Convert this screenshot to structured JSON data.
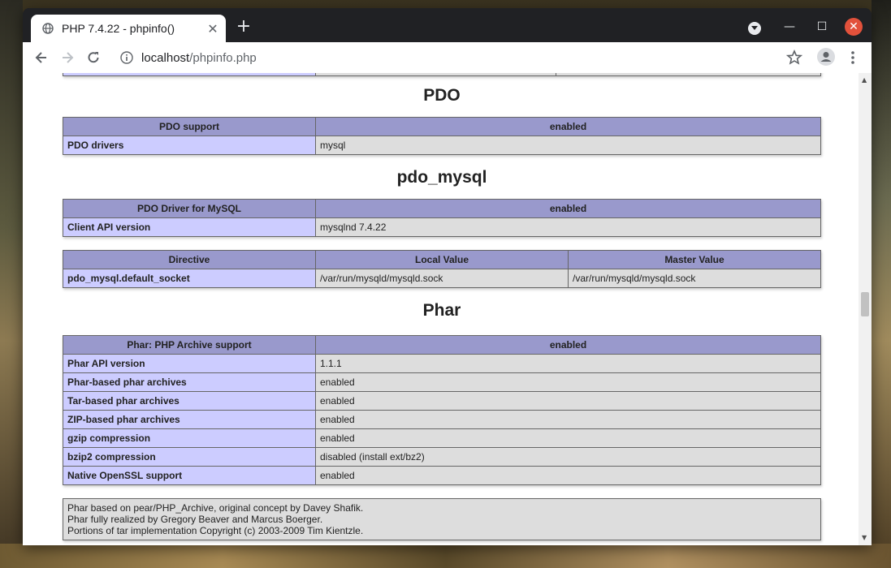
{
  "tab": {
    "title": "PHP 7.4.22 - phpinfo()"
  },
  "omnibox": {
    "host": "localhost",
    "path": "/phpinfo.php"
  },
  "sections": {
    "pdo": {
      "heading": "PDO",
      "header": [
        "PDO support",
        "enabled"
      ],
      "rows": [
        [
          "PDO drivers",
          "mysql"
        ]
      ]
    },
    "pdo_mysql": {
      "heading": "pdo_mysql",
      "header": [
        "PDO Driver for MySQL",
        "enabled"
      ],
      "rows": [
        [
          "Client API version",
          "mysqlnd 7.4.22"
        ]
      ],
      "directive_header": [
        "Directive",
        "Local Value",
        "Master Value"
      ],
      "directive_rows": [
        [
          "pdo_mysql.default_socket",
          "/var/run/mysqld/mysqld.sock",
          "/var/run/mysqld/mysqld.sock"
        ]
      ]
    },
    "phar": {
      "heading": "Phar",
      "header": [
        "Phar: PHP Archive support",
        "enabled"
      ],
      "rows": [
        [
          "Phar API version",
          "1.1.1"
        ],
        [
          "Phar-based phar archives",
          "enabled"
        ],
        [
          "Tar-based phar archives",
          "enabled"
        ],
        [
          "ZIP-based phar archives",
          "enabled"
        ],
        [
          "gzip compression",
          "enabled"
        ],
        [
          "bzip2 compression",
          "disabled (install ext/bz2)"
        ],
        [
          "Native OpenSSL support",
          "enabled"
        ]
      ],
      "notes": [
        "Phar based on pear/PHP_Archive, original concept by Davey Shafik.",
        "Phar fully realized by Gregory Beaver and Marcus Boerger.",
        "Portions of tar implementation Copyright (c) 2003-2009 Tim Kientzle."
      ]
    }
  },
  "icons": {
    "globe": "globe-icon",
    "close": "close-icon",
    "new_tab": "plus-icon",
    "back": "arrow-left-icon",
    "forward": "arrow-right-icon",
    "reload": "reload-icon",
    "info": "info-icon",
    "bookmark": "star-icon",
    "profile": "account-icon",
    "menu": "kebab-menu-icon"
  },
  "colors": {
    "header_bg": "#9999cc",
    "label_bg": "#ccccff",
    "value_bg": "#dddddd",
    "close_button": "#e2513b"
  }
}
